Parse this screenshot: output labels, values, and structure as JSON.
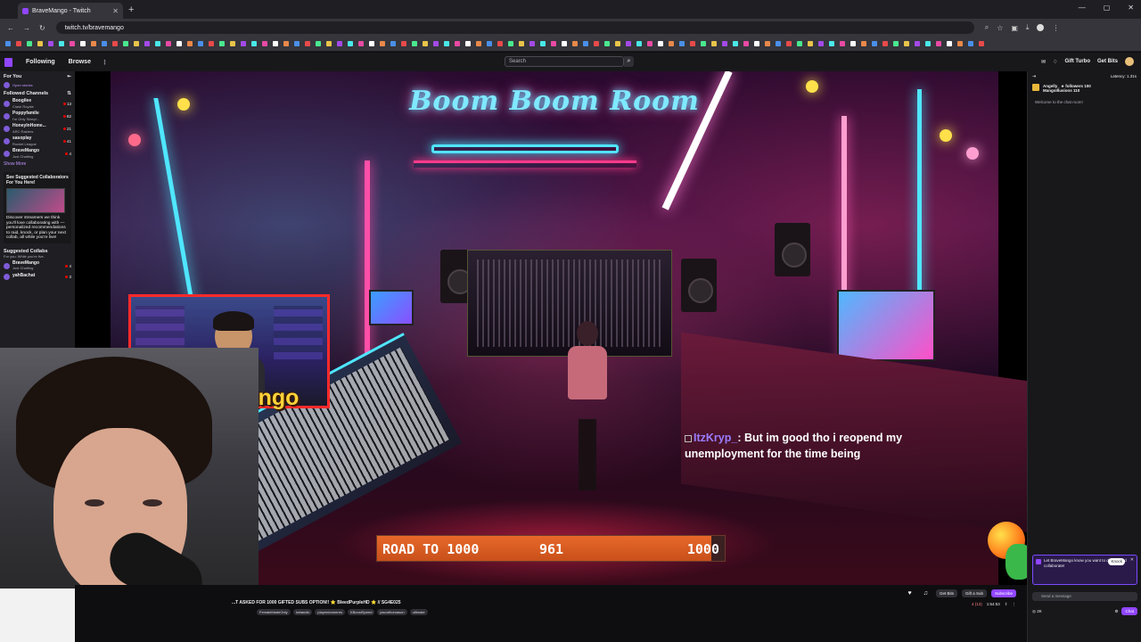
{
  "browser": {
    "tab_title": "BraveMango - Twitch",
    "url": "twitch.tv/bravemango"
  },
  "twitch_nav": {
    "following": "Following",
    "browse": "Browse",
    "search_placeholder": "Search",
    "turbo": "Gift Turbo",
    "get_bits": "Get Bits"
  },
  "sidebar": {
    "for_you": "For You",
    "open_stories": "Open stories",
    "followed_header": "Followed Channels",
    "channels": [
      {
        "name": "Boogilee",
        "category": "Clash Royale",
        "viewers": "13"
      },
      {
        "name": "Poppyfamile",
        "category": "I'm Only Sleepi...",
        "viewers": "82"
      },
      {
        "name": "HoneylnHome...",
        "category": "ARC Raiders",
        "viewers": "21"
      },
      {
        "name": "sasoplay",
        "category": "Rocket League",
        "viewers": "41"
      },
      {
        "name": "BraveMango",
        "category": "Just Chatting",
        "viewers": "4"
      }
    ],
    "show_more": "Show More",
    "suggestion_title": "See Suggested Collaborators For You Here!",
    "suggestion_body": "Discover streamers we think you'll love collaborating with — personalized recommendations to raid, knock, or plan your next collab, all while you're live!",
    "suggested_header": "Suggested Collabs",
    "suggested_sub": "For you. While you're live.",
    "suggested": [
      {
        "name": "BraveMango",
        "category": "Just Chatting",
        "viewers": "4"
      },
      {
        "name": "yahBachat",
        "category": "",
        "viewers": "3"
      }
    ]
  },
  "stream": {
    "overlay_title": "Boom Boom Room",
    "cam_name": "ravemango",
    "chat_user": "ItzKryp_",
    "chat_message": "But im good tho i reopend my unemployment for the time being",
    "goal_label": "ROAD TO 1000",
    "goal_current": "961",
    "goal_target": "1000",
    "goal_fraction": 0.961,
    "title": "...T ASKED FOR 1000 GIFTED SUBS OPTION!! ⭐ BleedPurpleHD ⭐ // SG4E025",
    "tags": [
      "FemaleMadeOnly",
      "Icelandic",
      "playerdonneres",
      "KBoostSpeed",
      "jasonthomason",
      "ultimate"
    ]
  },
  "actions": {
    "get_bits": "Get Bits",
    "gift_sub": "Gift a Sub",
    "subscribe": "Subscribe",
    "viewers": "4 (13)",
    "uptime": "1:54:53",
    "followers": "2K"
  },
  "chat": {
    "latency": "Latency: 1.31s",
    "top_gifters": [
      "Angelly_ ★ followers 100",
      "MangoIllusions 110"
    ],
    "welcome": "Welcome to the chat room!",
    "collab_text": "Let BraveMango know you want to drop in and collaborate!",
    "knock": "Knock",
    "input_placeholder": "Send a message",
    "points": "2K",
    "chat_button": "Chat"
  },
  "colors": {
    "twitch_purple": "#9146ff",
    "goal_orange": "#e8682a",
    "cam_border": "#ff2a2a"
  }
}
